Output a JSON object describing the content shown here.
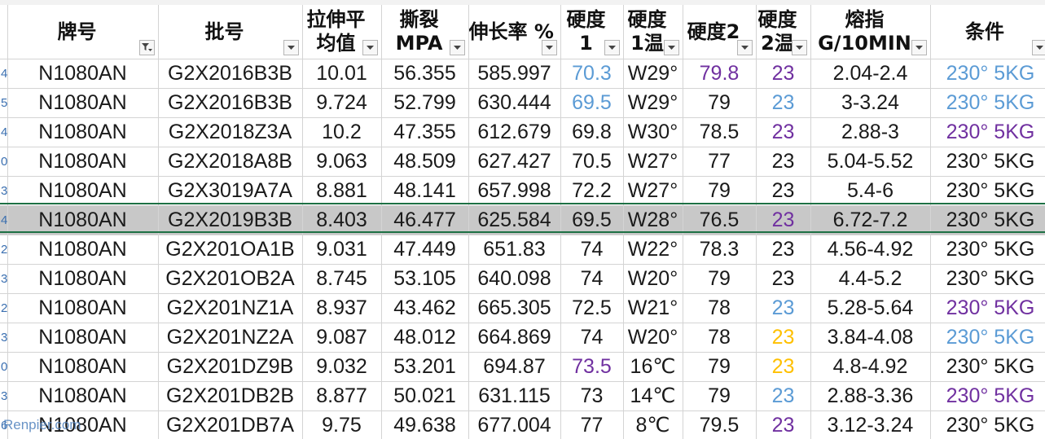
{
  "colors": {
    "header_text": "#111111",
    "grid": "#d4d4d4",
    "selection_fill": "#c8c8c8",
    "selection_border": "#1e7145",
    "blue_text": "#5b9bd5",
    "purple_text": "#7030a0",
    "gold_text": "#ffc000"
  },
  "headers": [
    {
      "label": "牌号",
      "filter": "active-filter"
    },
    {
      "label": "批号",
      "filter": "dropdown"
    },
    {
      "label": "拉伸平\n均值",
      "filter": "dropdown"
    },
    {
      "label": "撕裂\nMPA",
      "filter": "dropdown"
    },
    {
      "label": "伸长率 %",
      "filter": "dropdown"
    },
    {
      "label": "硬度\n1",
      "filter": "dropdown"
    },
    {
      "label": "硬度\n1温",
      "filter": "dropdown"
    },
    {
      "label": "硬度2",
      "filter": "dropdown"
    },
    {
      "label": "硬度\n2温",
      "filter": "dropdown"
    },
    {
      "label": "熔指\nG/10MIN",
      "filter": "dropdown"
    },
    {
      "label": "条件",
      "filter": "dropdown"
    }
  ],
  "row_numbers": [
    "4",
    "5",
    "4",
    "0",
    "3",
    "4",
    "2",
    "3",
    "2",
    "3",
    "0",
    "3",
    "6"
  ],
  "rows": [
    [
      "N1080AN",
      "G2X2016B3B",
      "10.01",
      "56.355",
      "585.997",
      "70.3",
      "W29°",
      "79.8",
      "23",
      "2.04-2.4",
      "230° 5KG"
    ],
    [
      "N1080AN",
      "G2X2016B3B",
      "9.724",
      "52.799",
      "630.444",
      "69.5",
      "W29°",
      "79",
      "23",
      "3-3.24",
      "230° 5KG"
    ],
    [
      "N1080AN",
      "G2X2018Z3A",
      "10.2",
      "47.355",
      "612.679",
      "69.8",
      "W30°",
      "78.5",
      "23",
      "2.88-3",
      "230° 5KG"
    ],
    [
      "N1080AN",
      "G2X2018A8B",
      "9.063",
      "48.509",
      "627.427",
      "70.5",
      "W27°",
      "77",
      "23",
      "5.04-5.52",
      "230° 5KG"
    ],
    [
      "N1080AN",
      "G2X3019A7A",
      "8.881",
      "48.141",
      "657.998",
      "72.2",
      "W27°",
      "79",
      "23",
      "5.4-6",
      "230° 5KG"
    ],
    [
      "N1080AN",
      "G2X2019B3B",
      "8.403",
      "46.477",
      "625.584",
      "69.5",
      "W28°",
      "76.5",
      "23",
      "6.72-7.2",
      "230° 5KG"
    ],
    [
      "N1080AN",
      "G2X201OA1B",
      "9.031",
      "47.449",
      "651.83",
      "74",
      "W22°",
      "78.3",
      "23",
      "4.56-4.92",
      "230° 5KG"
    ],
    [
      "N1080AN",
      "G2X201OB2A",
      "8.745",
      "53.105",
      "640.098",
      "74",
      "W20°",
      "79",
      "23",
      "4.4-5.2",
      "230° 5KG"
    ],
    [
      "N1080AN",
      "G2X201NZ1A",
      "8.937",
      "43.462",
      "665.305",
      "72.5",
      "W21°",
      "78",
      "23",
      "5.28-5.64",
      "230° 5KG"
    ],
    [
      "N1080AN",
      "G2X201NZ2A",
      "9.087",
      "48.012",
      "664.869",
      "74",
      "W20°",
      "78",
      "23",
      "3.84-4.08",
      "230° 5KG"
    ],
    [
      "N1080AN",
      "G2X201DZ9B",
      "9.032",
      "53.201",
      "694.87",
      "73.5",
      "16℃",
      "79",
      "23",
      "4.8-4.92",
      "230°  5KG"
    ],
    [
      "N1080AN",
      "G2X201DB2B",
      "8.877",
      "50.021",
      "631.115",
      "73",
      "14℃",
      "79",
      "23",
      "2.88-3.36",
      "230°  5KG"
    ],
    [
      "N1080AN",
      "G2X201DB7A",
      "9.75",
      "49.638",
      "677.004",
      "77",
      "8℃",
      "79.5",
      "23",
      "3.12-3.24",
      "230°  5KG"
    ]
  ],
  "cell_colors": {
    "0-5": "blue",
    "0-7": "purple",
    "0-8": "purple",
    "0-10": "blue",
    "1-5": "blue",
    "1-8": "blue",
    "1-10": "blue",
    "2-8": "purple",
    "2-10": "purple",
    "5-8": "purple",
    "8-8": "blue",
    "8-10": "purple",
    "9-8": "gold",
    "9-10": "blue",
    "10-5": "purple",
    "10-8": "gold",
    "11-8": "blue",
    "11-10": "purple",
    "12-8": "purple"
  },
  "selected_row": 5,
  "watermark": "Renpier.com"
}
